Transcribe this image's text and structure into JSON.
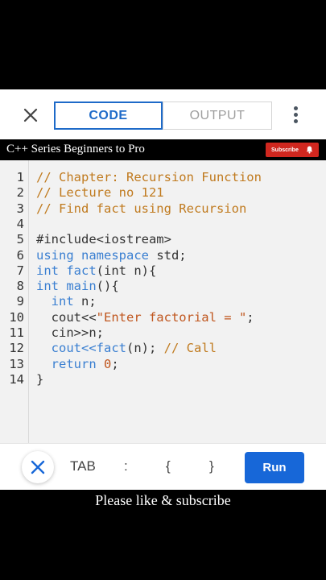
{
  "tabs": {
    "code": "CODE",
    "output": "OUTPUT"
  },
  "banner": {
    "title": "C++ Series Beginners to Pro",
    "subscribe": "Subscribe"
  },
  "code_lines": [
    {
      "num": "1",
      "parts": [
        {
          "t": "// Chapter: Recursion Function",
          "c": "comment"
        }
      ]
    },
    {
      "num": "2",
      "parts": [
        {
          "t": "// Lecture no 121",
          "c": "comment"
        }
      ]
    },
    {
      "num": "3",
      "parts": [
        {
          "t": "// Find fact using Recursion",
          "c": "comment"
        }
      ]
    },
    {
      "num": "4",
      "parts": []
    },
    {
      "num": "5",
      "parts": [
        {
          "t": "#include<iostream>",
          "c": "plain"
        }
      ]
    },
    {
      "num": "6",
      "parts": [
        {
          "t": "using namespace",
          "c": "kw"
        },
        {
          "t": " std;",
          "c": "plain"
        }
      ]
    },
    {
      "num": "7",
      "parts": [
        {
          "t": "int fact",
          "c": "kw"
        },
        {
          "t": "(int n){",
          "c": "plain"
        }
      ]
    },
    {
      "num": "8",
      "parts": [
        {
          "t": "int main",
          "c": "kw"
        },
        {
          "t": "(){",
          "c": "plain"
        }
      ]
    },
    {
      "num": "9",
      "parts": [
        {
          "t": "  ",
          "c": "plain"
        },
        {
          "t": "int",
          "c": "kw"
        },
        {
          "t": " n;",
          "c": "plain"
        }
      ]
    },
    {
      "num": "10",
      "parts": [
        {
          "t": "  cout<<",
          "c": "plain"
        },
        {
          "t": "\"Enter factorial = \"",
          "c": "str"
        },
        {
          "t": ";",
          "c": "plain"
        }
      ]
    },
    {
      "num": "11",
      "parts": [
        {
          "t": "  cin>>n;",
          "c": "plain"
        }
      ]
    },
    {
      "num": "12",
      "parts": [
        {
          "t": "  ",
          "c": "plain"
        },
        {
          "t": "cout<<fact",
          "c": "kw"
        },
        {
          "t": "(n); ",
          "c": "plain"
        },
        {
          "t": "// Call",
          "c": "comment"
        }
      ]
    },
    {
      "num": "13",
      "parts": [
        {
          "t": "  ",
          "c": "plain"
        },
        {
          "t": "return",
          "c": "kw"
        },
        {
          "t": " ",
          "c": "plain"
        },
        {
          "t": "0",
          "c": "num"
        },
        {
          "t": ";",
          "c": "plain"
        }
      ]
    },
    {
      "num": "14",
      "parts": [
        {
          "t": "}",
          "c": "plain"
        }
      ]
    }
  ],
  "caption": "Please like & subscribe",
  "toolbar": {
    "tab": "TAB",
    "colon": ":",
    "open_brace": "{",
    "close_brace": "}",
    "run": "Run"
  },
  "colors": {
    "accent": "#1e6ac8",
    "run": "#1767d8",
    "comment": "#c07a1e",
    "keyword": "#3a7fd1",
    "subscribe": "#d0271f"
  }
}
